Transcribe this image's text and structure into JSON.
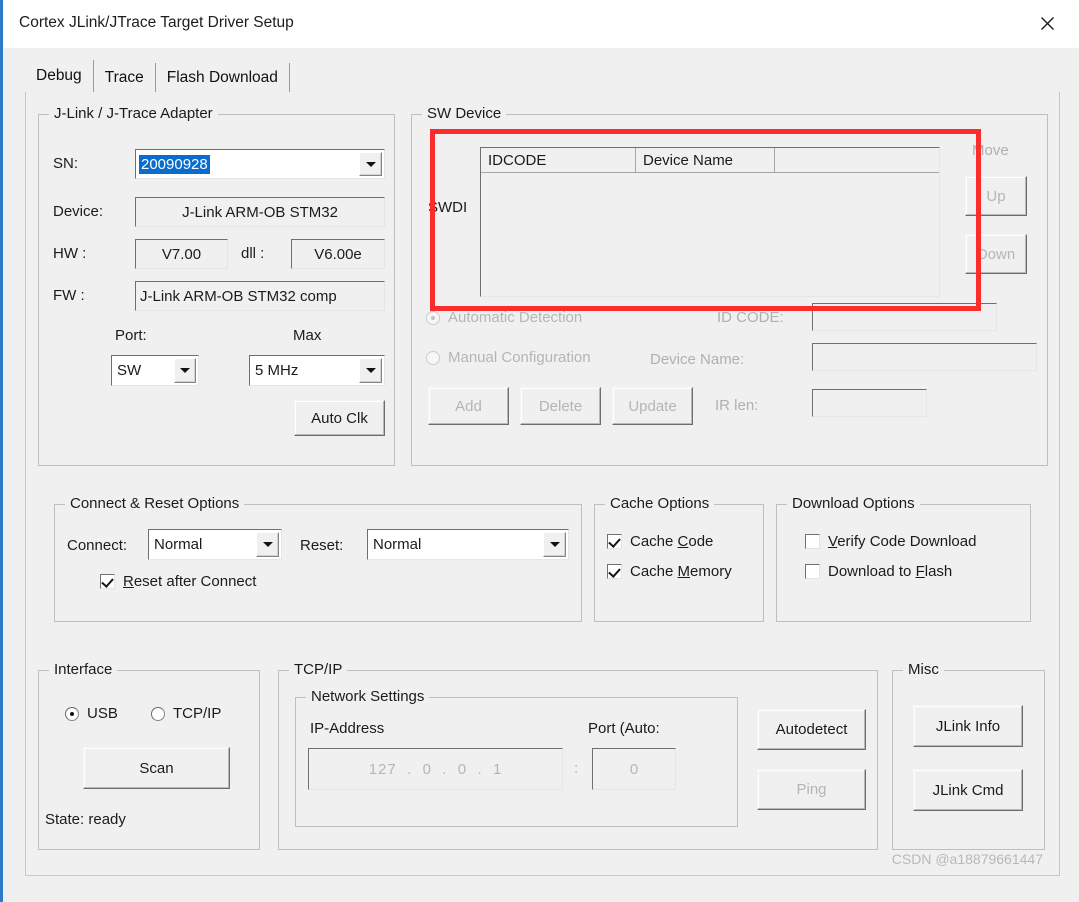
{
  "window": {
    "title": "Cortex JLink/JTrace Target Driver Setup",
    "close_label": "close-icon"
  },
  "tabs": [
    {
      "label": "Debug",
      "active": true
    },
    {
      "label": "Trace",
      "active": false
    },
    {
      "label": "Flash Download",
      "active": false
    }
  ],
  "adapter": {
    "group_title": "J-Link / J-Trace Adapter",
    "sn_label": "SN:",
    "sn_value": "20090928",
    "device_label": "Device:",
    "device_value": "J-Link ARM-OB STM32",
    "hw_label": "HW :",
    "hw_value": "V7.00",
    "dll_label": "dll :",
    "dll_value": "V6.00e",
    "fw_label": "FW :",
    "fw_value": "J-Link ARM-OB STM32 comp",
    "port_label": "Port:",
    "port_value": "SW",
    "max_label": "Max",
    "max_value": "5 MHz",
    "auto_clk_label": "Auto Clk"
  },
  "sw_device": {
    "group_title": "SW Device",
    "row_label": "SWDI",
    "columns": [
      "IDCODE",
      "Device Name",
      ""
    ],
    "rows": [],
    "move_label": "Move",
    "up_label": "Up",
    "down_label": "Down",
    "automatic_detection_label": "Automatic Detection",
    "manual_configuration_label": "Manual Configuration",
    "automatic_selected": true,
    "id_code_label": "ID CODE:",
    "id_code_value": "",
    "device_name_label": "Device Name:",
    "device_name_value": "",
    "ir_len_label": "IR len:",
    "ir_len_value": "",
    "add_label": "Add",
    "delete_label": "Delete",
    "update_label": "Update"
  },
  "connect_reset": {
    "group_title": "Connect & Reset Options",
    "connect_label": "Connect:",
    "connect_value": "Normal",
    "reset_label": "Reset:",
    "reset_value": "Normal",
    "reset_after_connect_label": "Reset after Connect",
    "reset_after_connect_checked": true
  },
  "cache": {
    "group_title": "Cache Options",
    "cache_code_label": "Cache Code",
    "cache_code_checked": true,
    "cache_memory_label": "Cache Memory",
    "cache_memory_checked": true
  },
  "download": {
    "group_title": "Download Options",
    "verify_code_label": "Verify Code Download",
    "verify_code_checked": false,
    "download_flash_label": "Download to Flash",
    "download_flash_checked": false
  },
  "interface": {
    "group_title": "Interface",
    "usb_label": "USB",
    "tcpip_label": "TCP/IP",
    "selected": "USB",
    "scan_label": "Scan",
    "state_label": "State: ready"
  },
  "tcpip": {
    "group_title": "TCP/IP",
    "network_settings_title": "Network Settings",
    "ip_address_label": "IP-Address",
    "ip_octets": [
      "127",
      "0",
      "0",
      "1"
    ],
    "port_label": "Port (Auto:",
    "port_separator": ":",
    "port_value": "0",
    "autodetect_label": "Autodetect",
    "ping_label": "Ping"
  },
  "misc": {
    "group_title": "Misc",
    "jlink_info_label": "JLink Info",
    "jlink_cmd_label": "JLink Cmd"
  },
  "annotation": {
    "color": "#fb2c2c",
    "shape": "rectangle"
  },
  "watermark": {
    "text": "CSDN @a18879661447"
  }
}
